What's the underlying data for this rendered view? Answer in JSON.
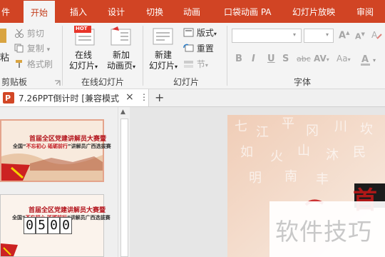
{
  "tabs": [
    {
      "label": "件",
      "active": false
    },
    {
      "label": "开始",
      "active": true
    },
    {
      "label": "插入",
      "active": false
    },
    {
      "label": "设计",
      "active": false
    },
    {
      "label": "切换",
      "active": false
    },
    {
      "label": "动画",
      "active": false
    },
    {
      "label": "口袋动画 PA",
      "active": false
    },
    {
      "label": "幻灯片放映",
      "active": false
    },
    {
      "label": "审阅",
      "active": false
    }
  ],
  "clipboard": {
    "paste_partial": "粘",
    "cut": "剪切",
    "copy": "复制",
    "format_painter": "格式刷",
    "group_label": "剪贴板"
  },
  "online_slides": {
    "hot_badge": "HOT",
    "online_l1": "在线",
    "online_l2": "幻灯片",
    "new_anim_l1": "新加",
    "new_anim_l2": "动画页",
    "group_label": "在线幻灯片"
  },
  "slides": {
    "new_l1": "新建",
    "new_l2": "幻灯片",
    "layout": "版式",
    "reset": "重置",
    "section": "节",
    "group_label": "幻灯片"
  },
  "font": {
    "group_label": "字体",
    "bold": "B",
    "italic": "I",
    "underline": "U",
    "shadow": "S",
    "strike": "abc",
    "spacing": "AV",
    "case": "Aa",
    "grow": "A",
    "shrink": "A"
  },
  "document": {
    "tab_title": "7.26PPT倒计时 [兼容模式",
    "close": "×",
    "more": "⋮",
    "add": "+"
  },
  "thumbnails": [
    {
      "title": "首届全区党建讲解员大赛暨",
      "subtitle_a": "全国“",
      "subtitle_hl": "不忘初心 砥砺前行",
      "subtitle_b": "”讲解员广西选拔赛"
    },
    {
      "title": "首届全区党建讲解员大赛暨",
      "subtitle_a": "全国“",
      "subtitle_hl": "不忘初心 砥砺前行",
      "subtitle_b": "”讲解员广西选拔赛",
      "digits": [
        "0",
        "5",
        "0",
        "0"
      ]
    }
  ],
  "main_slide": {
    "heading_partial": "首"
  },
  "watermark": "软件技巧",
  "colors": {
    "ribbon_accent": "#d14424",
    "slide_red": "#b3141c"
  }
}
